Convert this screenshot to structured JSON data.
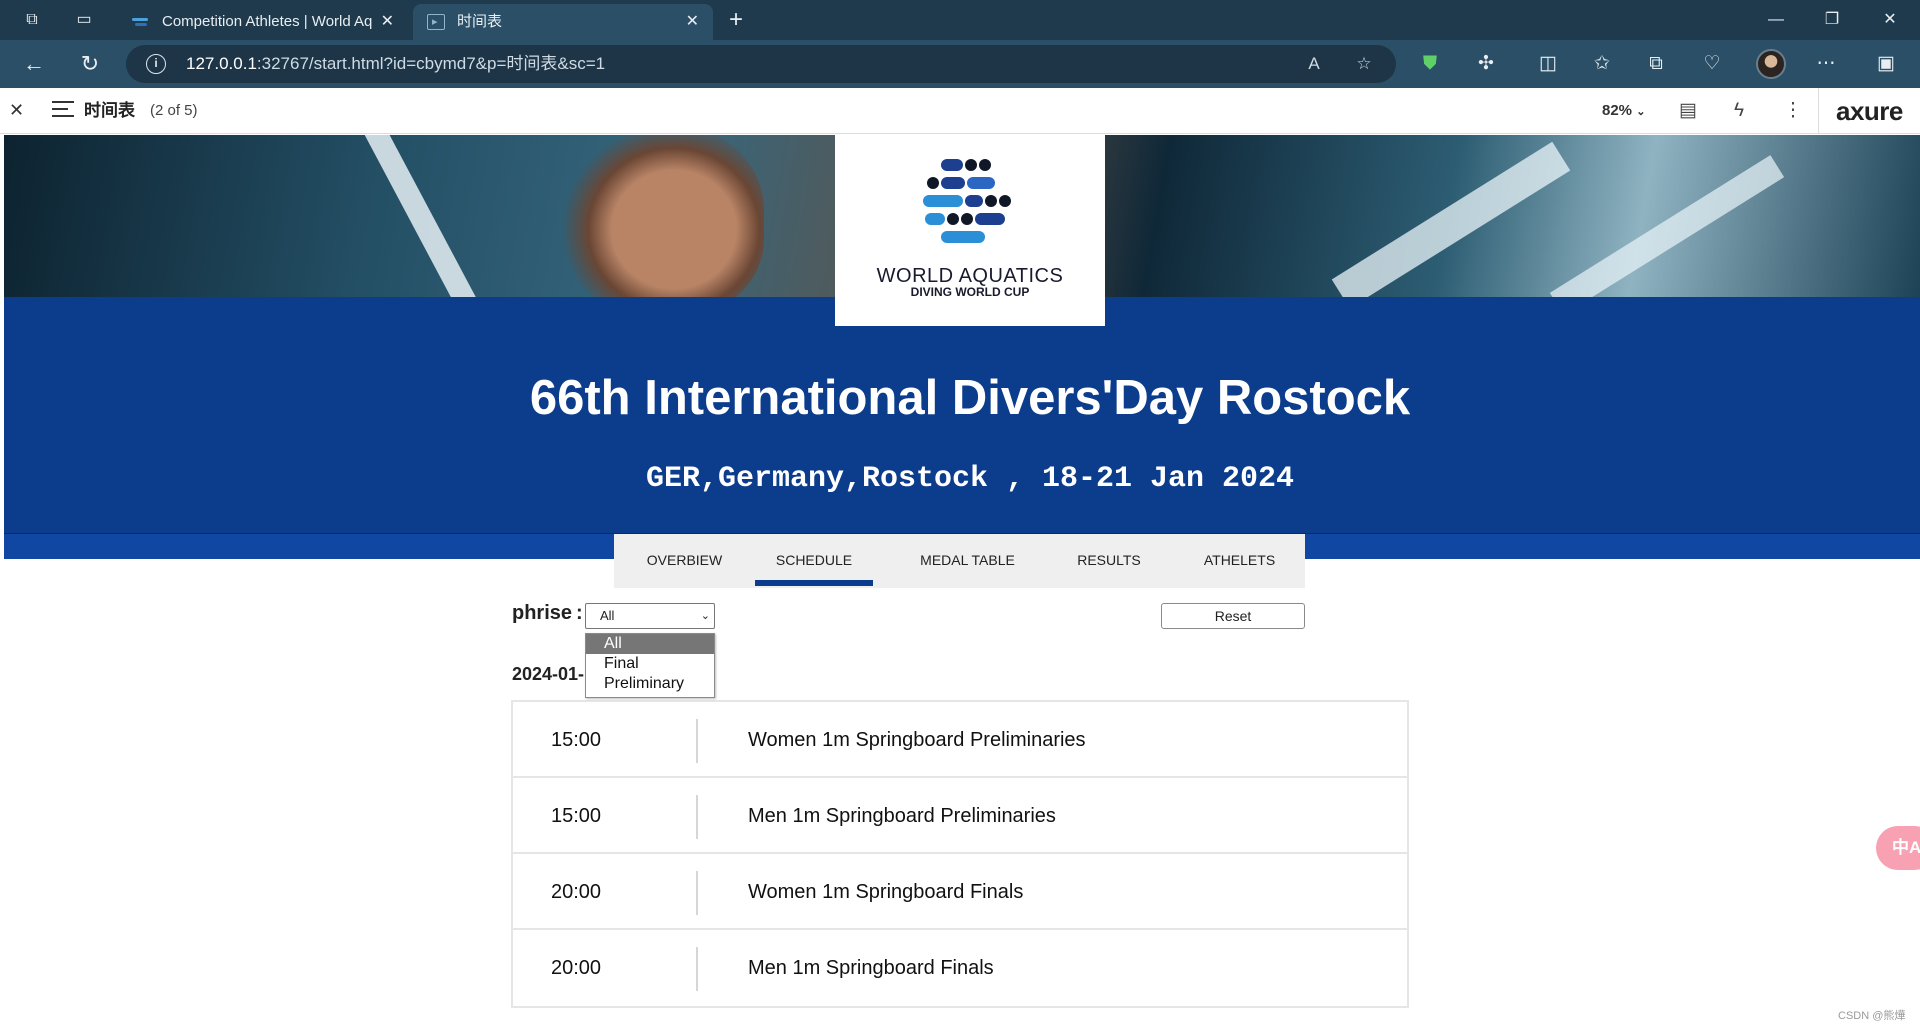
{
  "browser": {
    "tabs": [
      {
        "title": "Competition Athletes | World Aq",
        "active": false
      },
      {
        "title": "时间表",
        "active": true
      }
    ],
    "url_host": "127.0.0.1",
    "url_rest": ":32767/start.html?id=cbymd7&p=时间表&sc=1"
  },
  "axure": {
    "page_title": "时间表",
    "page_count": "(2 of 5)",
    "zoom": "82%",
    "logo": "axure"
  },
  "hero": {
    "org_name": "WORLD AQUATICS",
    "org_sub": "DIVING WORLD CUP",
    "event_title": "66th International Divers'Day Rostock",
    "event_sub": "GER,Germany,Rostock , 18-21 Jan 2024"
  },
  "nav_tabs": [
    {
      "label": "OVERBIEW"
    },
    {
      "label": "SCHEDULE"
    },
    {
      "label": "MEDAL TABLE"
    },
    {
      "label": "RESULTS"
    },
    {
      "label": "ATHELETS"
    }
  ],
  "filter": {
    "label": "phrise :",
    "selected": "All",
    "options": [
      "All",
      "Final",
      "Preliminary"
    ],
    "reset_label": "Reset"
  },
  "schedule": {
    "date": "2024-01-",
    "rows": [
      {
        "time": "15:00",
        "event": "Women 1m Springboard Preliminaries"
      },
      {
        "time": "15:00",
        "event": "Men 1m Springboard Preliminaries"
      },
      {
        "time": "20:00",
        "event": "Women 1m Springboard Finals"
      },
      {
        "time": "20:00",
        "event": "Men 1m Springboard Finals"
      }
    ]
  },
  "float_button": "中A",
  "watermark": "CSDN @熊燁",
  "colors": {
    "tabstrip": "#1f3a4d",
    "addressbar": "#2a4f66",
    "banner": "#0c3c8c",
    "accent": "#0c3c8c"
  }
}
